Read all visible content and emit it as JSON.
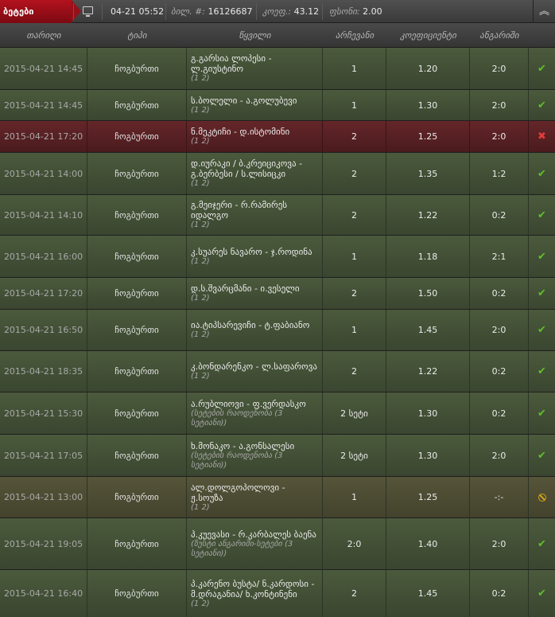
{
  "topbar": {
    "tab_label": "ბეტები",
    "datetime": "04-21 05:52",
    "ticket_label": "ბილ. #:",
    "ticket_value": "16126687",
    "coef_label": "კოეფ.:",
    "coef_value": "43.12",
    "stake_label": "ფსონი:",
    "stake_value": "2.00",
    "collapse_glyph": "︽"
  },
  "columns": [
    "თარიღი",
    "ტიპი",
    "წყვილი",
    "არჩევანი",
    "კოეფიციენტი",
    "ანგარიში"
  ],
  "status_icons": {
    "win": "check-icon",
    "lose": "cross-icon",
    "void": "void-icon"
  },
  "rows": [
    {
      "date": "2015-04-21 14:45",
      "type": "ჩოგბურთი",
      "event": "გ.გარსია ლოპესი - ლ.გიუსტინო",
      "sub": "(1 2)",
      "outcome": "1",
      "coef": "1.20",
      "result": "2:0",
      "status": "win"
    },
    {
      "date": "2015-04-21 14:45",
      "type": "ჩოგბურთი",
      "event": "ს.ბოლელი - ა.გოლუბევი",
      "sub": "(1 2)",
      "outcome": "1",
      "coef": "1.30",
      "result": "2:0",
      "status": "win"
    },
    {
      "date": "2015-04-21 17:20",
      "type": "ჩოგბურთი",
      "event": "ნ.მეკტიჩი - დ.ისტომინი",
      "sub": "(1 2)",
      "outcome": "2",
      "coef": "1.25",
      "result": "2:0",
      "status": "lose"
    },
    {
      "date": "2015-04-21 14:00",
      "type": "ჩოგბურთი",
      "event": "დ.იურაკი / ბ.კრეიციკოვა - გ.ბერბესი / ს.ლისიცკი",
      "sub": "(1 2)",
      "outcome": "2",
      "coef": "1.35",
      "result": "1:2",
      "status": "win"
    },
    {
      "date": "2015-04-21 14:10",
      "type": "ჩოგბურთი",
      "event": "გ.მეიჯერი - რ.რამირეს იდალგო",
      "sub": "(1 2)",
      "outcome": "2",
      "coef": "1.22",
      "result": "0:2",
      "status": "win"
    },
    {
      "date": "2015-04-21 16:00",
      "type": "ჩოგბურთი",
      "event": "კ.სუარეს ნავარო - ჯ.როდინა",
      "sub": "(1 2)",
      "outcome": "1",
      "coef": "1.18",
      "result": "2:1",
      "status": "win"
    },
    {
      "date": "2015-04-21 17:20",
      "type": "ჩოგბურთი",
      "event": "დ.ს.შვარცმანი - ი.ვესელი",
      "sub": "(1 2)",
      "outcome": "2",
      "coef": "1.50",
      "result": "0:2",
      "status": "win"
    },
    {
      "date": "2015-04-21 16:50",
      "type": "ჩოგბურთი",
      "event": "ია.ტიპსარევიჩი - ტ.ფაბიანო",
      "sub": "(1 2)",
      "outcome": "1",
      "coef": "1.45",
      "result": "2:0",
      "status": "win"
    },
    {
      "date": "2015-04-21 18:35",
      "type": "ჩოგბურთი",
      "event": "კ.ბონდარენკო - ლ.საფაროვა",
      "sub": "(1 2)",
      "outcome": "2",
      "coef": "1.22",
      "result": "0:2",
      "status": "win"
    },
    {
      "date": "2015-04-21 15:30",
      "type": "ჩოგბურთი",
      "event": "ა.რუბლიოვი - ფ.ვერდასკო",
      "sub": "(სეტების რაოდენობა (3 სეტიანი))",
      "outcome": "2 სეტი",
      "coef": "1.30",
      "result": "0:2",
      "status": "win"
    },
    {
      "date": "2015-04-21 17:05",
      "type": "ჩოგბურთი",
      "event": "ხ.მონაკო - ა.გონსალესი",
      "sub": "(სეტების რაოდენობა (3 სეტიანი))",
      "outcome": "2 სეტი",
      "coef": "1.30",
      "result": "2:0",
      "status": "win"
    },
    {
      "date": "2015-04-21 13:00",
      "type": "ჩოგბურთი",
      "event": "ალ.დოლგოპოლოვი - ჟ.სოუზა",
      "sub": "(1 2)",
      "outcome": "1",
      "coef": "1.25",
      "result": "-:-",
      "status": "void"
    },
    {
      "date": "2015-04-21 19:05",
      "type": "ჩოგბურთი",
      "event": "პ.კუევასი - რ.კარბალეს ბაენა",
      "sub": "(ზუსტი ანგარიში-სეტები (3 სეტიანი))",
      "outcome": "2:0",
      "coef": "1.40",
      "result": "2:0",
      "status": "win"
    },
    {
      "date": "2015-04-21 16:40",
      "type": "ჩოგბურთი",
      "event": "პ.კარენო ბუსტა/ ნ.კარდოსი - მ.დრაგანია/ ხ.კონტინენი",
      "sub": "(1 2)",
      "outcome": "2",
      "coef": "1.45",
      "result": "0:2",
      "status": "win"
    }
  ]
}
